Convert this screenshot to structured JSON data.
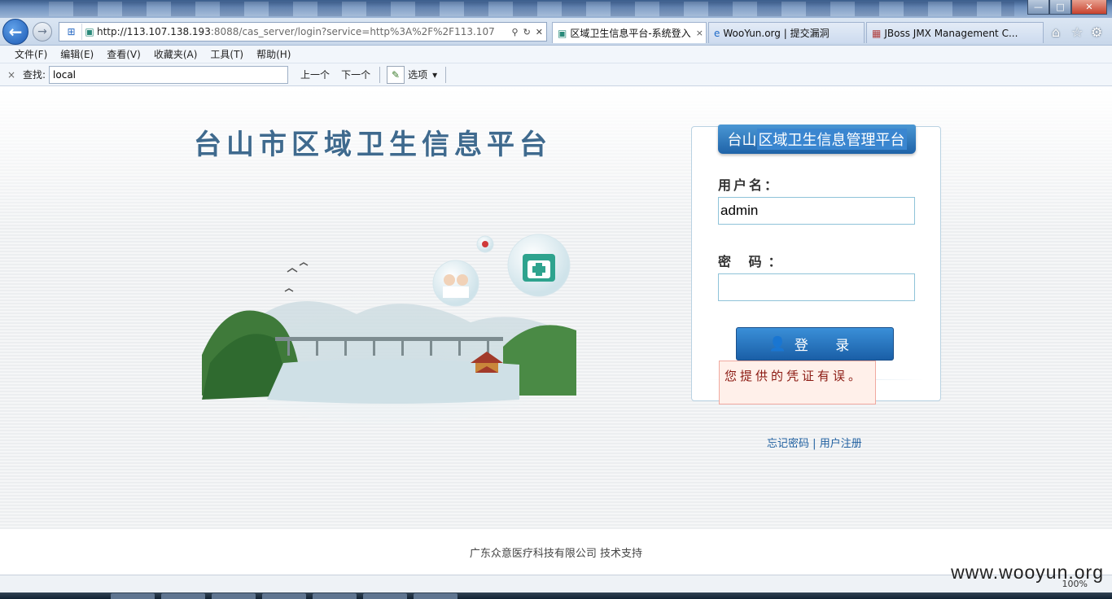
{
  "browser": {
    "url_host": "http://113.107.138.193",
    "url_rest": ":8088/cas_server/login?service=http%3A%2F%2F113.107",
    "tabs": [
      {
        "label": "区域卫生信息平台-系统登入",
        "close": "×"
      },
      {
        "label": "WooYun.org | 提交漏洞"
      },
      {
        "label": "JBoss JMX Management C..."
      }
    ],
    "window_buttons": {
      "minimize": "—",
      "maximize": "□",
      "close": "✕"
    }
  },
  "menu": [
    "文件(F)",
    "编辑(E)",
    "查看(V)",
    "收藏夹(A)",
    "工具(T)",
    "帮助(H)"
  ],
  "findbar": {
    "close": "×",
    "label": "查找:",
    "value": "local",
    "prev": "上一个",
    "next": "下一个",
    "options": "选项",
    "options_arrow": "▾"
  },
  "page": {
    "site_title": "台山市区域卫生信息平台",
    "login": {
      "header_prefix": "台山",
      "header_highlight": "区域卫生信息管理平台",
      "username_label": "用户名：",
      "username_value": "admin",
      "password_label": "密 码：",
      "password_value": "",
      "submit": "登 录",
      "error": "您提供的凭证有误。"
    },
    "links": {
      "forgot": "忘记密码",
      "divider": "|",
      "register": "用户注册"
    },
    "footer": "广东众意医疗科技有限公司 技术支持"
  },
  "status": {
    "zoom": "100%"
  },
  "watermark": "www.wooyun.org",
  "colors": {
    "accent": "#1f63a8",
    "title": "#3f6a8e",
    "error_bg": "#fff0ea",
    "error_text": "#8b1a12"
  },
  "icons": [
    "back-arrow-icon",
    "forward-arrow-icon",
    "home-icon",
    "star-icon",
    "gear-icon",
    "user-icon",
    "pen-icon"
  ]
}
